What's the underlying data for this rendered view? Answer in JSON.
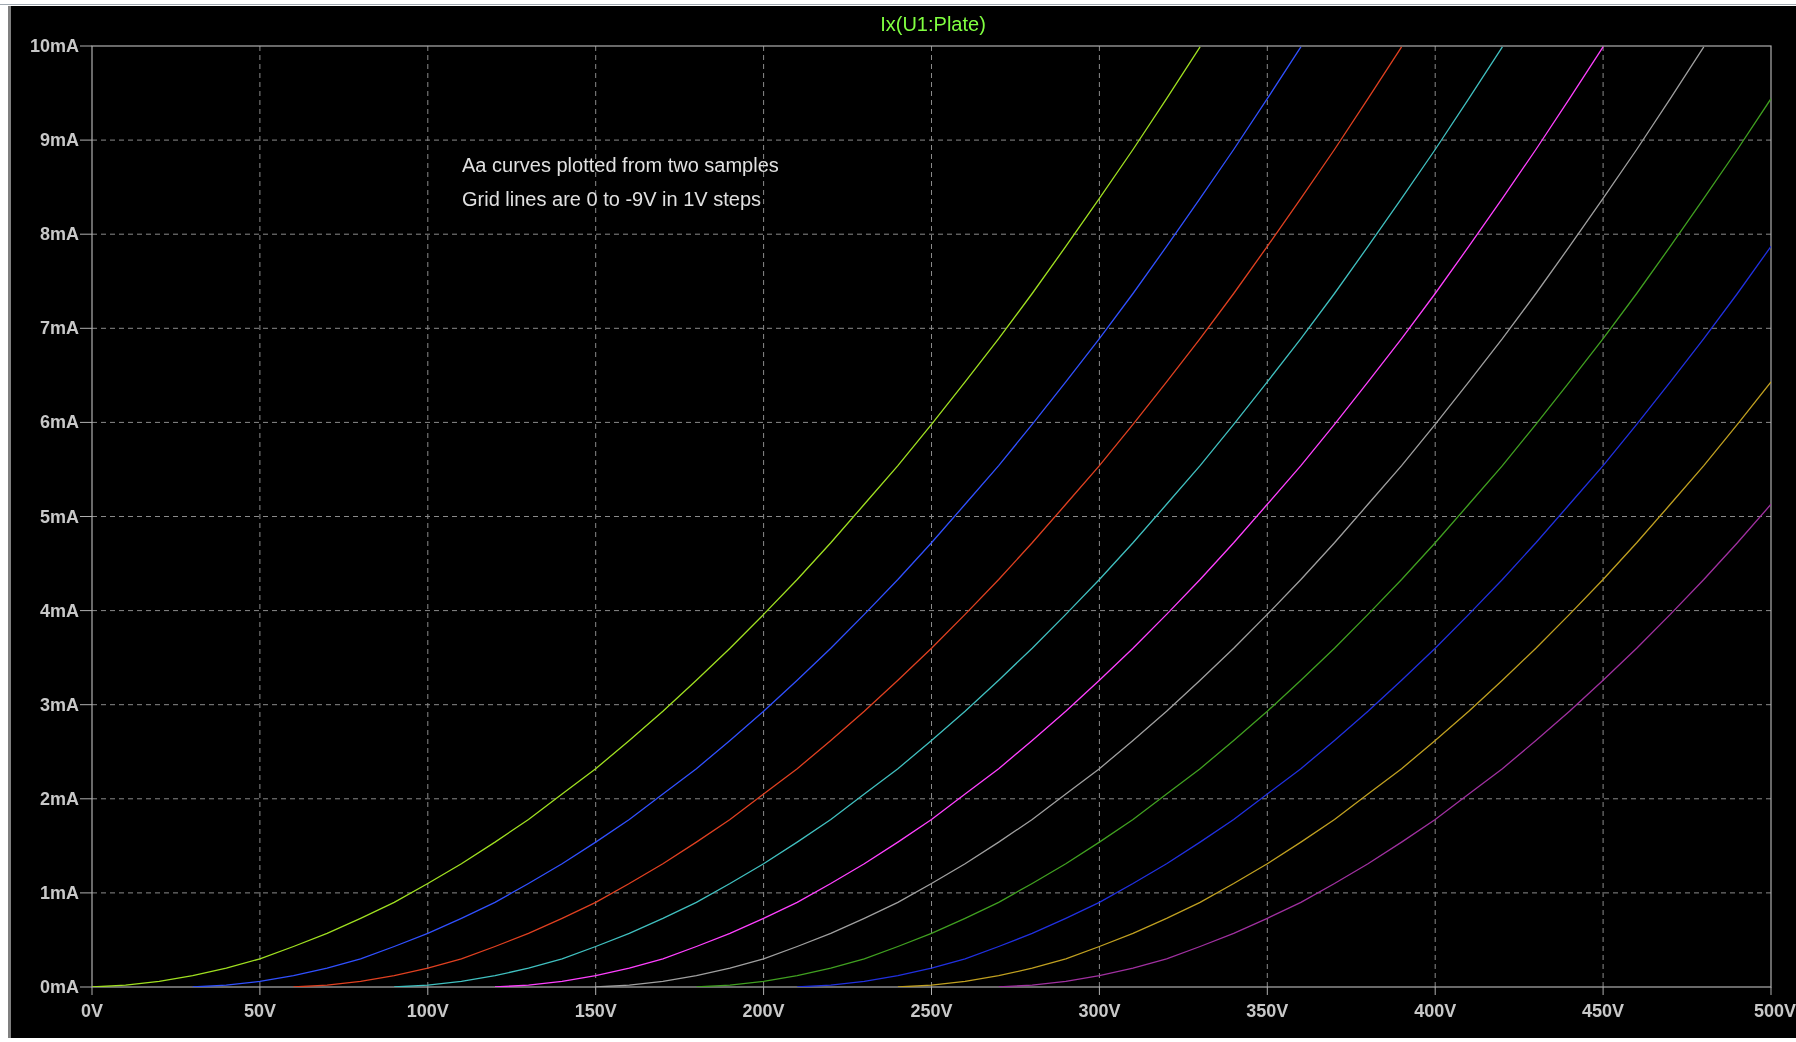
{
  "plot": {
    "chart_data": {
      "type": "line",
      "title": "Ix(U1:Plate)",
      "grid": true,
      "x": [
        0,
        10,
        20,
        30,
        40,
        50,
        60,
        70,
        80,
        90,
        100,
        110,
        120,
        130,
        140,
        150,
        160,
        170,
        180,
        190,
        200,
        210,
        220,
        230,
        240,
        250,
        260,
        270,
        280,
        290,
        300,
        310,
        320,
        330,
        340,
        350,
        360,
        370,
        380,
        390,
        400,
        410,
        420,
        430,
        440,
        450,
        460,
        470,
        480,
        490,
        500
      ],
      "series": [
        {
          "color": "#a0e020",
          "values": [
            0,
            0.02,
            0.06,
            0.12,
            0.2,
            0.3,
            0.43,
            0.57,
            0.73,
            0.9,
            1.1,
            1.31,
            1.54,
            1.78,
            2.05,
            2.32,
            2.62,
            2.93,
            3.26,
            3.6,
            3.96,
            4.33,
            4.72,
            5.13,
            5.54,
            5.98,
            6.43,
            6.89,
            7.37,
            7.87,
            8.38,
            8.9,
            9.44,
            9.99,
            null,
            null,
            null,
            null,
            null,
            null,
            null,
            null,
            null,
            null,
            null,
            null,
            null,
            null,
            null,
            null,
            null
          ]
        },
        {
          "color": "#3050ff",
          "values": [
            null,
            null,
            null,
            0,
            0.02,
            0.06,
            0.12,
            0.2,
            0.3,
            0.43,
            0.57,
            0.73,
            0.9,
            1.1,
            1.31,
            1.54,
            1.78,
            2.05,
            2.32,
            2.62,
            2.93,
            3.26,
            3.6,
            3.96,
            4.33,
            4.72,
            5.13,
            5.54,
            5.98,
            6.43,
            6.89,
            7.37,
            7.87,
            8.38,
            8.9,
            9.44,
            9.99,
            null,
            null,
            null,
            null,
            null,
            null,
            null,
            null,
            null,
            null,
            null,
            null,
            null,
            null
          ]
        },
        {
          "color": "#e04020",
          "values": [
            null,
            null,
            null,
            null,
            null,
            null,
            0,
            0.02,
            0.06,
            0.12,
            0.2,
            0.3,
            0.43,
            0.57,
            0.73,
            0.9,
            1.1,
            1.31,
            1.54,
            1.78,
            2.05,
            2.32,
            2.62,
            2.93,
            3.26,
            3.6,
            3.96,
            4.33,
            4.72,
            5.13,
            5.54,
            5.98,
            6.43,
            6.89,
            7.37,
            7.87,
            8.38,
            8.9,
            9.44,
            9.99,
            null,
            null,
            null,
            null,
            null,
            null,
            null,
            null,
            null,
            null,
            null
          ]
        },
        {
          "color": "#40c0c0",
          "values": [
            null,
            null,
            null,
            null,
            null,
            null,
            null,
            null,
            null,
            0,
            0.02,
            0.06,
            0.12,
            0.2,
            0.3,
            0.43,
            0.57,
            0.73,
            0.9,
            1.1,
            1.31,
            1.54,
            1.78,
            2.05,
            2.32,
            2.62,
            2.93,
            3.26,
            3.6,
            3.96,
            4.33,
            4.72,
            5.13,
            5.54,
            5.98,
            6.43,
            6.89,
            7.37,
            7.87,
            8.38,
            8.9,
            9.44,
            9.99,
            null,
            null,
            null,
            null,
            null,
            null,
            null,
            null
          ]
        },
        {
          "color": "#ff40ff",
          "values": [
            null,
            null,
            null,
            null,
            null,
            null,
            null,
            null,
            null,
            null,
            null,
            null,
            0,
            0.02,
            0.06,
            0.12,
            0.2,
            0.3,
            0.43,
            0.57,
            0.73,
            0.9,
            1.1,
            1.31,
            1.54,
            1.78,
            2.05,
            2.32,
            2.62,
            2.93,
            3.26,
            3.6,
            3.96,
            4.33,
            4.72,
            5.13,
            5.54,
            5.98,
            6.43,
            6.89,
            7.37,
            7.87,
            8.38,
            8.9,
            9.44,
            9.99,
            null,
            null,
            null,
            null,
            null
          ]
        },
        {
          "color": "#a0a0a0",
          "values": [
            null,
            null,
            null,
            null,
            null,
            null,
            null,
            null,
            null,
            null,
            null,
            null,
            null,
            null,
            null,
            0,
            0.02,
            0.06,
            0.12,
            0.2,
            0.3,
            0.43,
            0.57,
            0.73,
            0.9,
            1.1,
            1.31,
            1.54,
            1.78,
            2.05,
            2.32,
            2.62,
            2.93,
            3.26,
            3.6,
            3.96,
            4.33,
            4.72,
            5.13,
            5.54,
            5.98,
            6.43,
            6.89,
            7.37,
            7.87,
            8.38,
            8.9,
            9.44,
            9.99,
            null,
            null
          ]
        },
        {
          "color": "#40a020",
          "values": [
            null,
            null,
            null,
            null,
            null,
            null,
            null,
            null,
            null,
            null,
            null,
            null,
            null,
            null,
            null,
            null,
            null,
            null,
            0,
            0.02,
            0.06,
            0.12,
            0.2,
            0.3,
            0.43,
            0.57,
            0.73,
            0.9,
            1.1,
            1.31,
            1.54,
            1.78,
            2.05,
            2.32,
            2.62,
            2.93,
            3.26,
            3.6,
            3.96,
            4.33,
            4.72,
            5.13,
            5.54,
            5.98,
            6.43,
            6.89,
            7.37,
            7.87,
            8.38,
            8.9,
            9.44
          ]
        },
        {
          "color": "#2030e0",
          "values": [
            null,
            null,
            null,
            null,
            null,
            null,
            null,
            null,
            null,
            null,
            null,
            null,
            null,
            null,
            null,
            null,
            null,
            null,
            null,
            null,
            null,
            0,
            0.02,
            0.06,
            0.12,
            0.2,
            0.3,
            0.43,
            0.57,
            0.73,
            0.9,
            1.1,
            1.31,
            1.54,
            1.78,
            2.05,
            2.32,
            2.62,
            2.93,
            3.26,
            3.6,
            3.96,
            4.33,
            4.72,
            5.13,
            5.54,
            5.98,
            6.43,
            6.89,
            7.37,
            7.87
          ]
        },
        {
          "color": "#c0a020",
          "values": [
            null,
            null,
            null,
            null,
            null,
            null,
            null,
            null,
            null,
            null,
            null,
            null,
            null,
            null,
            null,
            null,
            null,
            null,
            null,
            null,
            null,
            null,
            null,
            null,
            0,
            0.02,
            0.06,
            0.12,
            0.2,
            0.3,
            0.43,
            0.57,
            0.73,
            0.9,
            1.1,
            1.31,
            1.54,
            1.78,
            2.05,
            2.32,
            2.62,
            2.93,
            3.26,
            3.6,
            3.96,
            4.33,
            4.72,
            5.13,
            5.54,
            5.98,
            6.43
          ]
        },
        {
          "color": "#a030a0",
          "values": [
            null,
            null,
            null,
            null,
            null,
            null,
            null,
            null,
            null,
            null,
            null,
            null,
            null,
            null,
            null,
            null,
            null,
            null,
            null,
            null,
            null,
            null,
            null,
            null,
            null,
            null,
            null,
            0,
            0.02,
            0.06,
            0.12,
            0.2,
            0.3,
            0.43,
            0.57,
            0.73,
            0.9,
            1.1,
            1.31,
            1.54,
            1.78,
            2.05,
            2.32,
            2.62,
            2.93,
            3.26,
            3.6,
            3.96,
            4.33,
            4.72,
            5.13
          ]
        }
      ],
      "xlim": [
        0,
        500
      ],
      "ylim": [
        0,
        10
      ],
      "xticks": [
        {
          "value": 0,
          "label": "0V"
        },
        {
          "value": 50,
          "label": "50V"
        },
        {
          "value": 100,
          "label": "100V"
        },
        {
          "value": 150,
          "label": "150V"
        },
        {
          "value": 200,
          "label": "200V"
        },
        {
          "value": 250,
          "label": "250V"
        },
        {
          "value": 300,
          "label": "300V"
        },
        {
          "value": 350,
          "label": "350V"
        },
        {
          "value": 400,
          "label": "400V"
        },
        {
          "value": 450,
          "label": "450V"
        },
        {
          "value": 500,
          "label": "500V"
        }
      ],
      "yticks": [
        {
          "value": 0,
          "label": "0mA"
        },
        {
          "value": 1,
          "label": "1mA"
        },
        {
          "value": 2,
          "label": "2mA"
        },
        {
          "value": 3,
          "label": "3mA"
        },
        {
          "value": 4,
          "label": "4mA"
        },
        {
          "value": 5,
          "label": "5mA"
        },
        {
          "value": 6,
          "label": "6mA"
        },
        {
          "value": 7,
          "label": "7mA"
        },
        {
          "value": 8,
          "label": "8mA"
        },
        {
          "value": 9,
          "label": "9mA"
        },
        {
          "value": 10,
          "label": "10mA"
        }
      ],
      "annotations": [
        "Aa curves plotted from two samples",
        "Grid lines are 0 to -9V in 1V steps"
      ]
    }
  }
}
